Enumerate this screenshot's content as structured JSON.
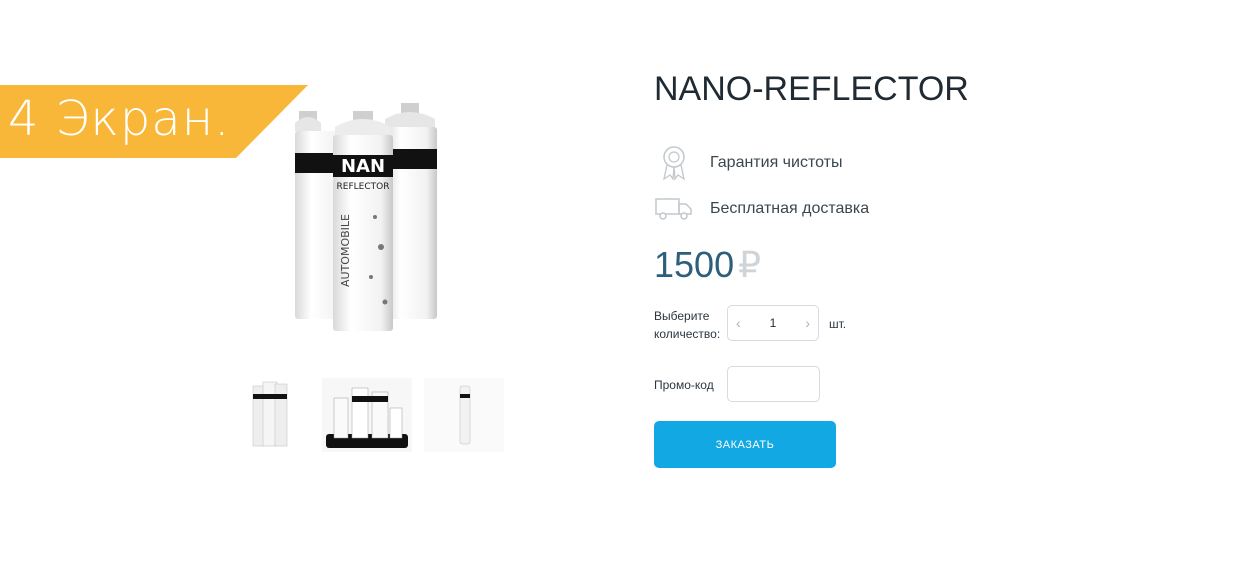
{
  "banner": {
    "text": "4 Экран.",
    "color": "#f8b738"
  },
  "gallery": {
    "main_image": "spray-cans-product-image",
    "thumbnails": [
      "three-cans-thumbnail",
      "cans-group-thumbnail",
      "single-can-thumbnail"
    ]
  },
  "product": {
    "title": "NANO-REFLECTOR",
    "features": [
      {
        "icon": "award-badge-icon",
        "label": "Гарантия чистоты"
      },
      {
        "icon": "delivery-truck-icon",
        "label": "Бесплатная доставка"
      }
    ],
    "price": "1500",
    "currency": "₽",
    "quantity_label_line1": "Выберите",
    "quantity_label_line2": "количество:",
    "quantity_value": "1",
    "quantity_decrement": "‹",
    "quantity_increment": "›",
    "unit": "шт.",
    "promo_label": "Промо-код",
    "promo_value": "",
    "order_button": "ЗАКАЗАТЬ"
  },
  "colors": {
    "accent": "#12a8e3",
    "price": "#2c5f7a",
    "banner": "#f8b738"
  }
}
